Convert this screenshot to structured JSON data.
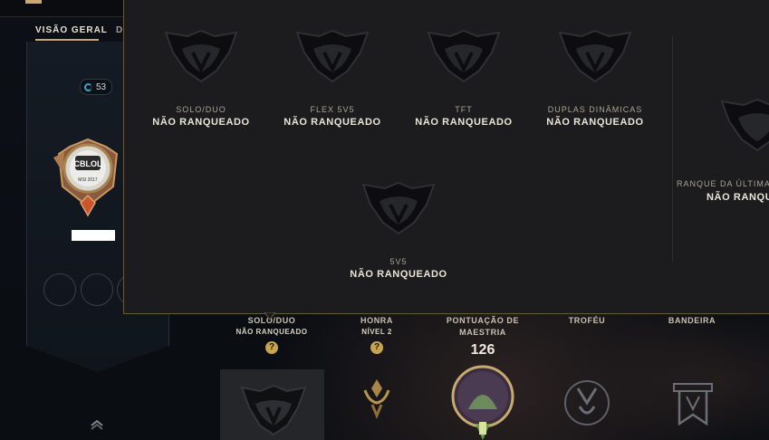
{
  "nav": {
    "tabs": [
      "VISÃO GERAL",
      "D"
    ]
  },
  "banner": {
    "mastery_count": "53",
    "crest_text": "CBLOL",
    "crest_sub": "MSI 2017"
  },
  "ranked_popup": {
    "queues": [
      {
        "name": "SOLO/DUO",
        "rank": "NÃO RANQUEADO"
      },
      {
        "name": "FLEX 5V5",
        "rank": "NÃO RANQUEADO"
      },
      {
        "name": "TFT",
        "rank": "NÃO RANQUEADO"
      },
      {
        "name": "DUPLAS DINÂMICAS",
        "rank": "NÃO RANQUEADO"
      },
      {
        "name": "5V5",
        "rank": "NÃO RANQUEADO"
      }
    ],
    "last_season": {
      "name": "RANQUE DA ÚLTIMA",
      "rank": "NÃO RANQU"
    }
  },
  "profile_stats": {
    "solo": {
      "title": "SOLO/DUO",
      "sub": "NÃO RANQUEADO",
      "help": "?"
    },
    "honor": {
      "title": "HONRA",
      "sub": "NÍVEL 2",
      "help": "?"
    },
    "mastery": {
      "title_line1": "PONTUAÇÃO DE",
      "title_line2": "MAESTRIA",
      "score": "126"
    },
    "trophy": {
      "title": "TROFÉU"
    },
    "banner": {
      "title": "BANDEIRA"
    }
  },
  "colors": {
    "gold": "#c8aa6e",
    "popup_bg": "#1c1c1e",
    "help_badge": "#c8a54a",
    "mastery_ring": "#3ea4c4"
  },
  "icons": [
    "ranked-emblem-icon",
    "honor-icon",
    "champion-mastery-icon",
    "trophy-icon",
    "banner-icon",
    "chevron-up-icon",
    "mastery-ring-icon"
  ]
}
